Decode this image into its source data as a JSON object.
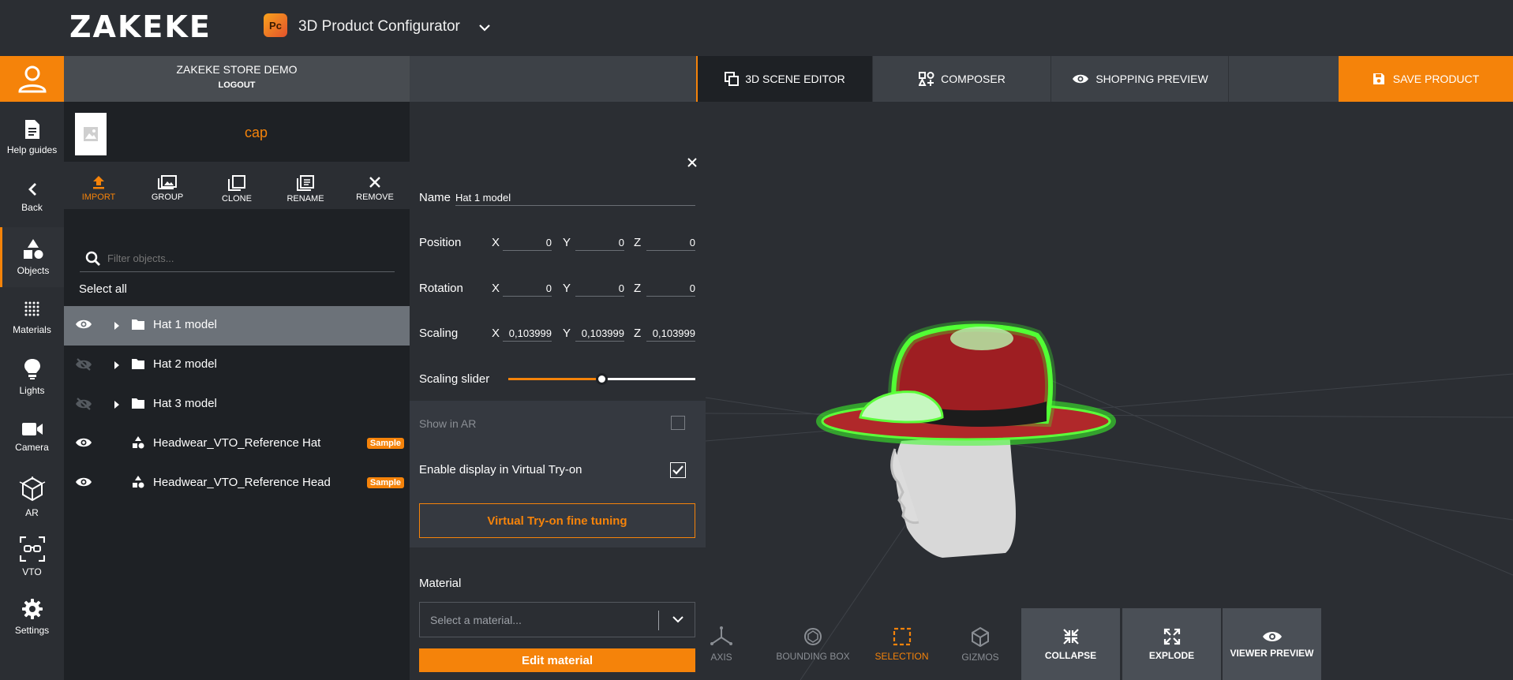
{
  "app": {
    "logo": "ZAKEKE",
    "badge": "Pc",
    "title": "3D Product Configurator"
  },
  "user": {
    "store_name": "ZAKEKE STORE DEMO",
    "logout_label": "LOGOUT"
  },
  "tabs": [
    {
      "label": "3D SCENE EDITOR",
      "icon": "copy-icon"
    },
    {
      "label": "COMPOSER",
      "icon": "composer-icon"
    },
    {
      "label": "SHOPPING PREVIEW",
      "icon": "eye-icon"
    }
  ],
  "save_label": "SAVE PRODUCT",
  "sidebar": [
    {
      "label": "Help guides",
      "icon": "document-icon"
    },
    {
      "label": "Back",
      "icon": "chevron-left-icon"
    },
    {
      "label": "Objects",
      "icon": "shapes-icon"
    },
    {
      "label": "Materials",
      "icon": "dots-grid-icon"
    },
    {
      "label": "Lights",
      "icon": "bulb-icon"
    },
    {
      "label": "Camera",
      "icon": "video-camera-icon"
    },
    {
      "label": "AR",
      "icon": "cube-icon"
    },
    {
      "label": "VTO",
      "icon": "glasses-icon"
    },
    {
      "label": "Settings",
      "icon": "gear-icon"
    }
  ],
  "objects_panel": {
    "title": "cap",
    "toolbar": [
      {
        "label": "IMPORT",
        "icon": "upload-icon"
      },
      {
        "label": "GROUP",
        "icon": "images-icon"
      },
      {
        "label": "CLONE",
        "icon": "clone-icon"
      },
      {
        "label": "RENAME",
        "icon": "rename-icon"
      },
      {
        "label": "REMOVE",
        "icon": "close-icon"
      }
    ],
    "search_placeholder": "Filter objects...",
    "select_all": "Select all",
    "items": [
      {
        "label": "Hat 1 model",
        "visible": true,
        "type": "folder",
        "selected": true
      },
      {
        "label": "Hat 2 model",
        "visible": false,
        "type": "folder"
      },
      {
        "label": "Hat 3 model",
        "visible": false,
        "type": "folder"
      },
      {
        "label": "Headwear_VTO_Reference Hat",
        "visible": true,
        "type": "mesh",
        "badge": "Sample"
      },
      {
        "label": "Headwear_VTO_Reference Head",
        "visible": true,
        "type": "mesh",
        "badge": "Sample"
      }
    ]
  },
  "properties": {
    "name_label": "Name",
    "name_value": "Hat 1 model",
    "position_label": "Position",
    "rotation_label": "Rotation",
    "scaling_label": "Scaling",
    "axis_x": "X",
    "axis_y": "Y",
    "axis_z": "Z",
    "position": {
      "x": "0",
      "y": "0",
      "z": "0"
    },
    "rotation": {
      "x": "0",
      "y": "0",
      "z": "0"
    },
    "scaling": {
      "x": "0,103999",
      "y": "0,103999",
      "z": "0,103999"
    },
    "scaling_slider_label": "Scaling slider",
    "scaling_slider_level": 0.5,
    "show_in_ar_label": "Show in AR",
    "show_in_ar": false,
    "enable_vto_label": "Enable display in Virtual Try-on",
    "enable_vto": true,
    "fine_tuning_label": "Virtual Try-on fine tuning",
    "material_label": "Material",
    "material_placeholder": "Select a material...",
    "edit_material_label": "Edit material"
  },
  "viewport_tools": [
    {
      "label": "AXIS",
      "icon": "axis-icon"
    },
    {
      "label": "BOUNDING BOX",
      "icon": "bounding-box-icon"
    },
    {
      "label": "SELECTION",
      "icon": "selection-icon",
      "active": true
    },
    {
      "label": "GIZMOS",
      "icon": "gizmos-icon"
    },
    {
      "label": "COLLAPSE",
      "icon": "collapse-icon"
    },
    {
      "label": "EXPLODE",
      "icon": "explode-icon"
    },
    {
      "label": "VIEWER PREVIEW",
      "icon": "eye-icon"
    }
  ],
  "colors": {
    "accent": "#f5830a",
    "panel_dark": "#1e2125",
    "background": "#2b2e33",
    "selection_glow": "#3cff2a"
  }
}
